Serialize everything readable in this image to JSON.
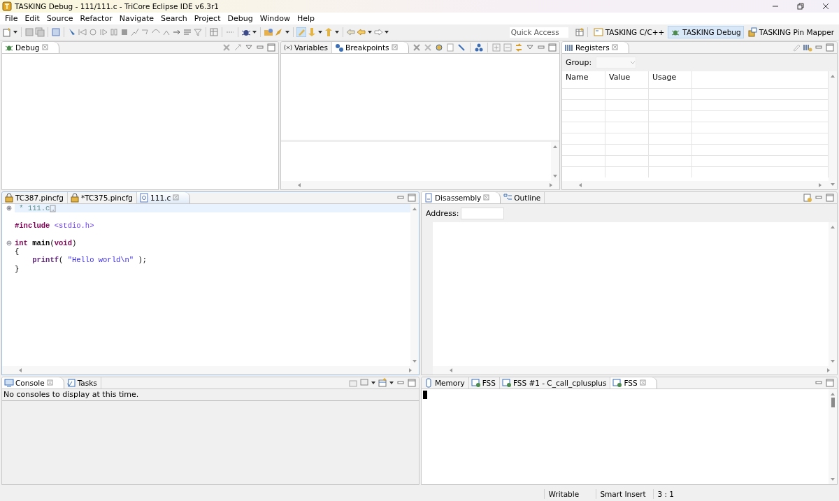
{
  "window": {
    "title": "TASKING Debug - 111/111.c - TriCore Eclipse IDE v6.3r1"
  },
  "menu": [
    {
      "label": "File"
    },
    {
      "label": "Edit"
    },
    {
      "label": "Source"
    },
    {
      "label": "Refactor"
    },
    {
      "label": "Navigate"
    },
    {
      "label": "Search"
    },
    {
      "label": "Project"
    },
    {
      "label": "Debug"
    },
    {
      "label": "Window"
    },
    {
      "label": "Help"
    }
  ],
  "toolbar": {
    "quick_access": {
      "placeholder": "Quick Access"
    },
    "perspectives": [
      {
        "label": "TASKING C/C++",
        "selected": false
      },
      {
        "label": "TASKING Debug",
        "selected": true
      },
      {
        "label": "TASKING Pin Mapper",
        "selected": false
      }
    ]
  },
  "debug_view": {
    "tabs": [
      {
        "label": "Debug",
        "selected": true
      }
    ]
  },
  "variables_view": {
    "tabs": [
      {
        "label": "Variables",
        "selected": false
      },
      {
        "label": "Breakpoints",
        "selected": true
      }
    ]
  },
  "registers_view": {
    "tabs": [
      {
        "label": "Registers",
        "selected": true
      }
    ],
    "group_label": "Group:",
    "columns": [
      "Name",
      "Value",
      "Usage"
    ]
  },
  "editor": {
    "active": true,
    "tabs": [
      {
        "label": "TC387.pincfg",
        "selected": false
      },
      {
        "label": "*TC375.pincfg",
        "selected": false
      },
      {
        "label": "111.c",
        "selected": true
      }
    ],
    "lines": [
      {
        "kind": "code",
        "highlighted": true,
        "collapsed": true,
        "tokens": [
          {
            "kind": "comment",
            "text": " * 111.c"
          }
        ]
      },
      {
        "kind": "blank",
        "highlighted": false
      },
      {
        "kind": "code",
        "highlighted": false,
        "tokens": [
          {
            "kind": "keyword",
            "text": "#include"
          },
          {
            "kind": "header",
            "text": " <stdio.h>"
          }
        ]
      },
      {
        "kind": "blank",
        "highlighted": false
      },
      {
        "kind": "code",
        "highlighted": false,
        "collapsed": false,
        "tokens": [
          {
            "kind": "keyword",
            "text": "int"
          },
          {
            "kind": "bold",
            "text": " main"
          },
          {
            "kind": "plain",
            "text": "("
          },
          {
            "kind": "keyword",
            "text": "void"
          },
          {
            "kind": "plain",
            "text": ")"
          }
        ]
      },
      {
        "kind": "code",
        "highlighted": false,
        "tokens": [
          {
            "kind": "plain",
            "text": "{"
          }
        ]
      },
      {
        "kind": "code",
        "highlighted": false,
        "tokens": [
          {
            "kind": "function",
            "text": "    printf"
          },
          {
            "kind": "plain",
            "text": "( "
          },
          {
            "kind": "string",
            "text": "\"Hello world\\n\""
          },
          {
            "kind": "plain",
            "text": " );"
          }
        ]
      },
      {
        "kind": "code",
        "highlighted": false,
        "tokens": [
          {
            "kind": "plain",
            "text": "}"
          }
        ]
      }
    ]
  },
  "disassembly_view": {
    "tabs": [
      {
        "label": "Disassembly",
        "selected": true
      },
      {
        "label": "Outline",
        "selected": false
      }
    ],
    "address_label": "Address:"
  },
  "console_view": {
    "tabs": [
      {
        "label": "Console",
        "selected": true
      },
      {
        "label": "Tasks",
        "selected": false
      }
    ],
    "message": "No consoles to display at this time."
  },
  "memory_view": {
    "tabs": [
      {
        "label": "Memory",
        "selected": false
      },
      {
        "label": "FSS",
        "selected": false
      },
      {
        "label": "FSS #1 - C_call_cplusplus",
        "selected": false
      },
      {
        "label": "FSS",
        "selected": true
      }
    ]
  },
  "status_bar": [
    "Writable",
    "Smart Insert",
    "3 : 1"
  ]
}
